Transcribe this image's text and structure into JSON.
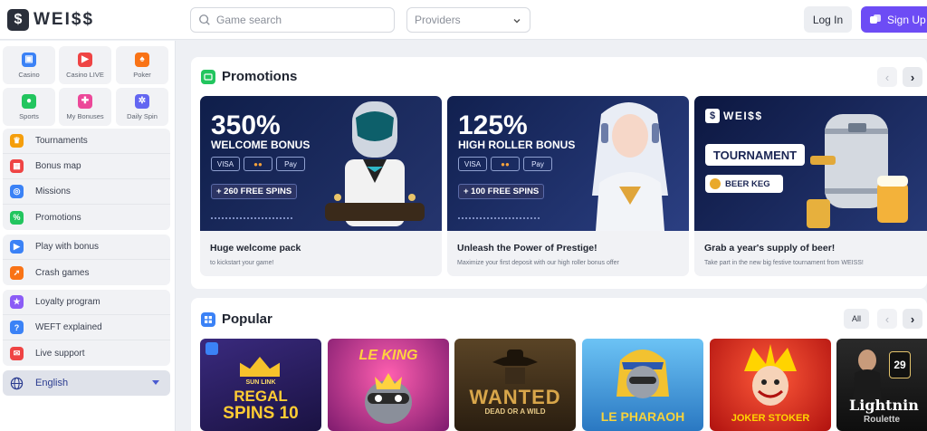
{
  "header": {
    "logo_text": "WEI$$",
    "logo_badge": "$",
    "search_placeholder": "Game search",
    "providers_label": "Providers",
    "login_label": "Log In",
    "signup_label": "Sign Up"
  },
  "sidebar": {
    "tiles": [
      {
        "label": "Casino",
        "icon": "casino-icon",
        "color": "#3b82f6"
      },
      {
        "label": "Casino LIVE",
        "icon": "casino-live-icon",
        "color": "#ef4444"
      },
      {
        "label": "Poker",
        "icon": "poker-icon",
        "color": "#f97316"
      },
      {
        "label": "Sports",
        "icon": "sports-icon",
        "color": "#22c55e"
      },
      {
        "label": "My Bonuses",
        "icon": "gift-icon",
        "color": "#ec4899"
      },
      {
        "label": "Daily Spin",
        "icon": "daily-spin-icon",
        "color": "#6366f1"
      }
    ],
    "group1": [
      {
        "label": "Tournaments",
        "icon": "trophy-icon",
        "color": "#f59e0b"
      },
      {
        "label": "Bonus map",
        "icon": "map-icon",
        "color": "#ef4444"
      },
      {
        "label": "Missions",
        "icon": "target-icon",
        "color": "#3b82f6"
      },
      {
        "label": "Promotions",
        "icon": "promotions-icon",
        "color": "#22c55e"
      }
    ],
    "group2": [
      {
        "label": "Play with bonus",
        "icon": "play-bonus-icon",
        "color": "#3b82f6"
      },
      {
        "label": "Crash games",
        "icon": "rocket-icon",
        "color": "#f97316"
      }
    ],
    "group3": [
      {
        "label": "Loyalty program",
        "icon": "loyalty-icon",
        "color": "#8b5cf6"
      },
      {
        "label": "WEFT explained",
        "icon": "help-icon",
        "color": "#3b82f6"
      },
      {
        "label": "Live support",
        "icon": "support-icon",
        "color": "#ef4444"
      }
    ],
    "language": "English"
  },
  "promotions": {
    "title": "Promotions",
    "prev": "‹",
    "next": "›",
    "cards": [
      {
        "big": "350%",
        "bonus_name": "WELCOME BONUS",
        "payments": [
          "VISA",
          "●●",
          "Pay"
        ],
        "spins": "+ 260 FREE SPINS",
        "title": "Huge welcome pack",
        "subtitle": "to kickstart your game!",
        "bg_from": "#0f1e4a",
        "bg_to": "#25356e"
      },
      {
        "big": "125%",
        "bonus_name": "HIGH ROLLER BONUS",
        "payments": [
          "VISA",
          "●●",
          "Pay"
        ],
        "spins": "+ 100 FREE SPINS",
        "title": "Unleash the Power of Prestige!",
        "subtitle": "Maximize your first deposit with our high roller bonus offer",
        "bg_from": "#11204f",
        "bg_to": "#2b3f82"
      },
      {
        "logo": "WEI$$",
        "tournament": "TOURNAMENT",
        "keg": "BEER KEG",
        "title": "Grab a year's supply of beer!",
        "subtitle": "Take part in the new big festive tournament from WEISS!",
        "bg_from": "#0c1740",
        "bg_to": "#263977"
      }
    ]
  },
  "popular": {
    "title": "Popular",
    "all_label": "All",
    "prev": "‹",
    "next": "›",
    "games": [
      {
        "name": "REGAL SPINS 10",
        "line1": "SUN LINK",
        "line2": "REGAL",
        "line3": "SPINS 10",
        "bg": "#2a1a5e",
        "accent": "#f6c22b"
      },
      {
        "name": "LE KING",
        "line1": "",
        "line2": "LE KING",
        "line3": "",
        "bg": "#b42d7c",
        "accent": "#ffd23f"
      },
      {
        "name": "WANTED DEAD OR A WILD",
        "line1": "",
        "line2": "WANTED",
        "line3": "DEAD OR A WILD",
        "bg": "#3a2a16",
        "accent": "#d8a64a"
      },
      {
        "name": "LE PHARAOH",
        "line1": "",
        "line2": "LE PHARAOH",
        "line3": "",
        "bg": "#2a8fd6",
        "accent": "#f7d23b"
      },
      {
        "name": "JOKER STOKER",
        "line1": "",
        "line2": "JOKER STOKER",
        "line3": "",
        "bg": "#d6221f",
        "accent": "#ffd400"
      },
      {
        "name": "Lightning Roulette",
        "line1": "29",
        "line2": "Lightnin",
        "line3": "Roulette",
        "bg": "#1a1a1a",
        "accent": "#e2c26b"
      }
    ]
  }
}
